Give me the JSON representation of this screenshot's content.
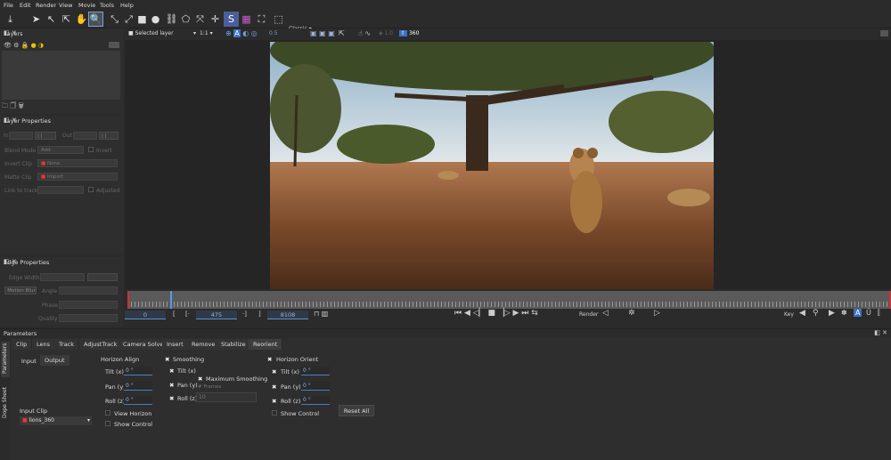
{
  "menu": [
    "File",
    "Edit",
    "Render",
    "View",
    "Movie",
    "Tools",
    "Help"
  ],
  "toolbar": {
    "view_mode": "Classic"
  },
  "viewer_bar": {
    "layer_select": "Selected layer",
    "ratio": "1:1",
    "opacity": "0.5",
    "zoom_val": "1.0",
    "mode_360": "360"
  },
  "layers_panel": {
    "title": "Layers"
  },
  "layer_properties": {
    "title": "Layer Properties",
    "in_label": "In",
    "out_label": "Out",
    "blend_mode_label": "Blend Mode",
    "blend_mode_value": "Add",
    "invert_label": "Invert",
    "invert_clip_label": "Invert Clip",
    "invert_clip_value": "None",
    "matte_clip_label": "Matte Clip",
    "matte_clip_value": "Import",
    "link_track_label": "Link to track",
    "adjusted_label": "Adjusted"
  },
  "edge_properties": {
    "title": "Edge Properties",
    "edge_width_label": "Edge Width",
    "motion_blur_label": "Motion Blur",
    "angle_label": "Angle",
    "phase_label": "Phase",
    "quality_label": "Quality"
  },
  "timeline": {
    "current_frame": "0",
    "in_frame": "475",
    "out_frame": "8108",
    "render_label": "Render",
    "key_label": "Key"
  },
  "parameters": {
    "title": "Parameters",
    "side_tabs": [
      "Parameters",
      "Dope Sheet"
    ],
    "tabs": [
      "Clip",
      "Lens",
      "Track",
      "AdjustTrack",
      "Camera Solve",
      "Insert",
      "Remove",
      "Stabilize",
      "Reorient"
    ],
    "io_tabs": [
      "Input",
      "Output"
    ],
    "horizon_align": {
      "title": "Horizon Align",
      "tilt_label": "Tilt (x)",
      "tilt": "0 °",
      "pan_label": "Pan (y)",
      "pan": "0 °",
      "roll_label": "Roll (z)",
      "roll": "0 °",
      "view_horizon": "View Horizon",
      "show_control": "Show Control"
    },
    "smoothing": {
      "title": "Smoothing",
      "tilt_label": "Tilt (x)",
      "pan_label": "Pan (y)",
      "roll_label": "Roll (z)",
      "max_label": "Maximum Smoothing",
      "frames_placeholder": "# Frames",
      "frames_value": "10"
    },
    "horizon_orient": {
      "title": "Horizon Orient",
      "tilt_label": "Tilt (x)",
      "tilt": "0 °",
      "pan_label": "Pan (y)",
      "pan": "0 °",
      "roll_label": "Roll (z)",
      "roll": "0 °",
      "show_control": "Show Control"
    },
    "input_clip_label": "Input Clip",
    "input_clip_value": "lions_360",
    "reset_all": "Reset All"
  }
}
